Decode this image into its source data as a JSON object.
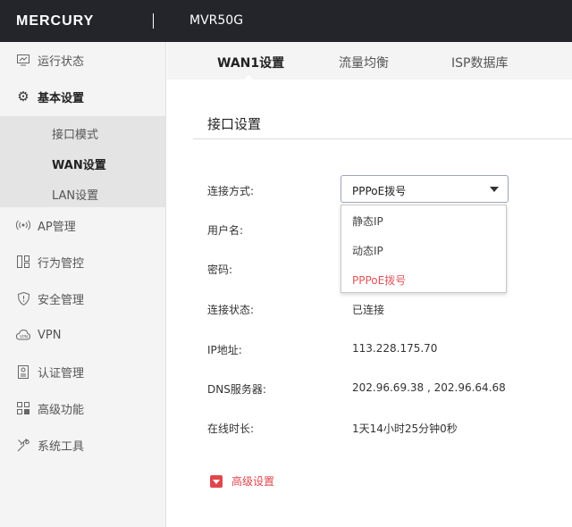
{
  "header": {
    "brand": "MERCURY",
    "model": "MVR50G"
  },
  "sidebar": {
    "items": [
      {
        "label": "运行状态",
        "icon": "monitor-icon"
      },
      {
        "label": "基本设置",
        "icon": "gear-icon",
        "expanded": true,
        "children": [
          {
            "label": "接口模式"
          },
          {
            "label": "WAN设置",
            "active": true
          },
          {
            "label": "LAN设置"
          }
        ]
      },
      {
        "label": "AP管理",
        "icon": "wireless-ap-icon"
      },
      {
        "label": "行为管控",
        "icon": "behavior-control-icon"
      },
      {
        "label": "安全管理",
        "icon": "shield-icon"
      },
      {
        "label": "VPN",
        "icon": "vpn-cloud-icon"
      },
      {
        "label": "认证管理",
        "icon": "auth-id-icon"
      },
      {
        "label": "高级功能",
        "icon": "grid-icon"
      },
      {
        "label": "系统工具",
        "icon": "tools-icon"
      }
    ]
  },
  "tabs": [
    {
      "label": "WAN1设置",
      "active": true
    },
    {
      "label": "流量均衡"
    },
    {
      "label": "ISP数据库"
    }
  ],
  "section": {
    "title": "接口设置"
  },
  "form": {
    "connection_type": {
      "label": "连接方式:",
      "value": "PPPoE拨号"
    },
    "username": {
      "label": "用户名:"
    },
    "password": {
      "label": "密码:"
    },
    "status": {
      "label": "连接状态:",
      "value": "已连接"
    },
    "ip": {
      "label": "IP地址:",
      "value": "113.228.175.70"
    },
    "dns": {
      "label": "DNS服务器:",
      "value": "202.96.69.38 , 202.96.64.68"
    },
    "uptime": {
      "label": "在线时长:",
      "value": "1天14小时25分钟0秒"
    }
  },
  "dropdown": {
    "options": [
      "静态IP",
      "动态IP",
      "PPPoE拨号"
    ],
    "selected_index": 2
  },
  "advanced": {
    "label": "高级设置"
  },
  "colors": {
    "header_bg": "#24252b",
    "accent": "#e0474c",
    "sidebar_bg": "#f4f4f4",
    "submenu_bg": "#e4e4e4"
  }
}
